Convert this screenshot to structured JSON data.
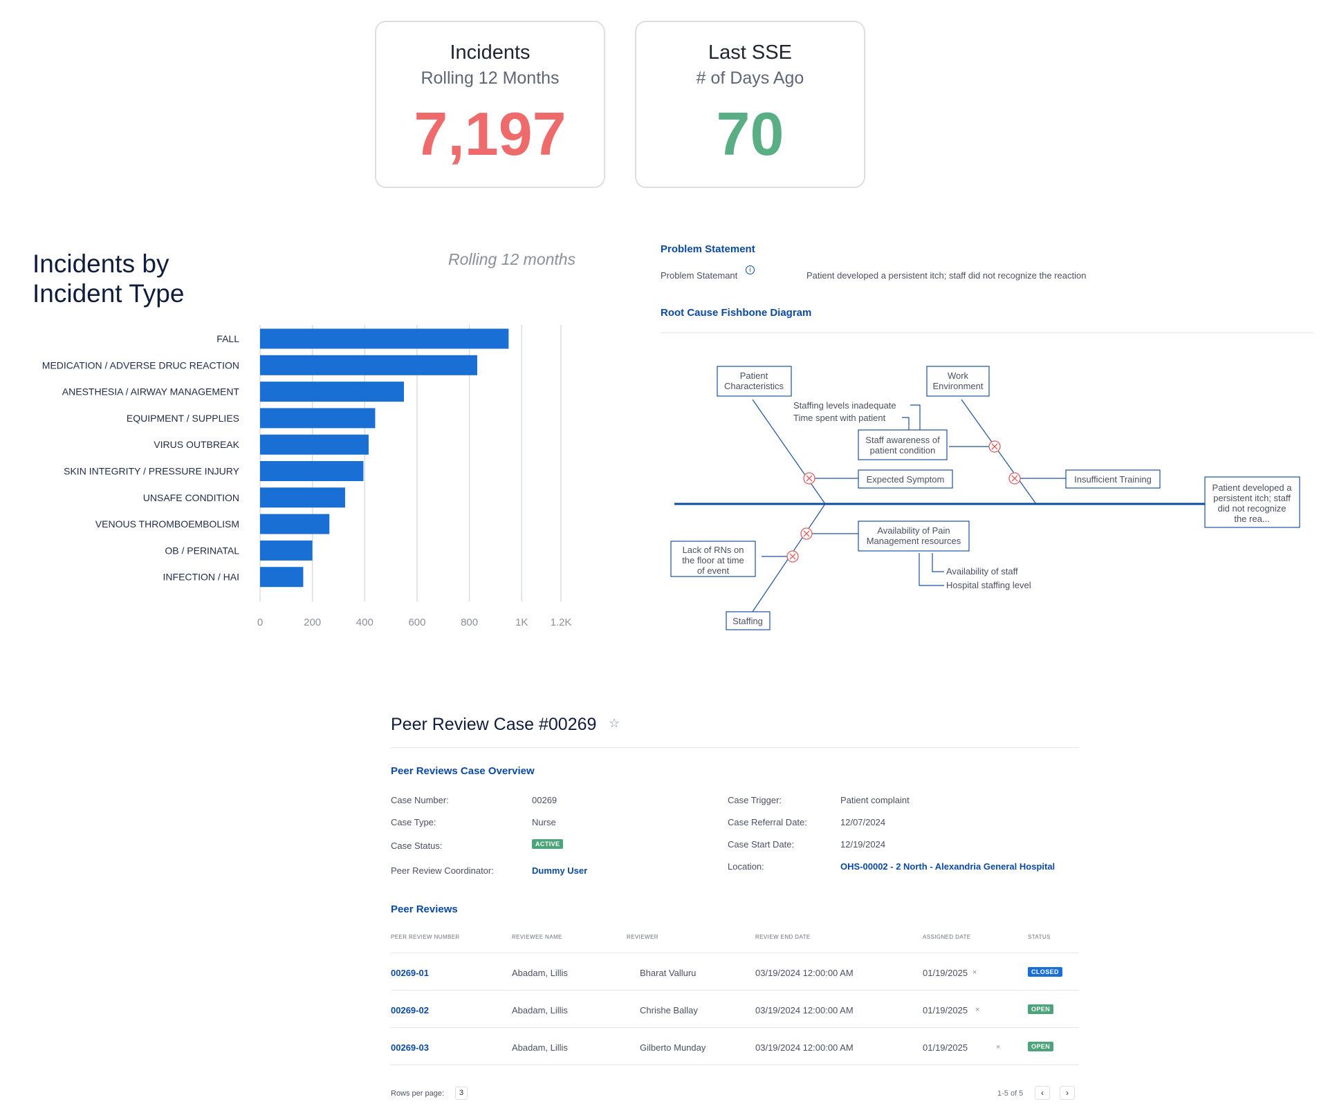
{
  "kpis": [
    {
      "title": "Incidents",
      "subtitle": "Rolling 12 Months",
      "value": "7,197",
      "color": "#ef6b6b"
    },
    {
      "title": "Last SSE",
      "subtitle": "# of Days Ago",
      "value": "70",
      "color": "#5aae84"
    }
  ],
  "bar_chart": {
    "title_line1": "Incidents by",
    "title_line2": "Incident Type",
    "subtitle": "Rolling 12 months"
  },
  "chart_data": {
    "type": "bar",
    "orientation": "horizontal",
    "categories": [
      "FALL",
      "MEDICATION / ADVERSE DRUC REACTION",
      "ANESTHESIA / AIRWAY MANAGEMENT",
      "EQUIPMENT / SUPPLIES",
      "VIRUS OUTBREAK",
      "SKIN INTEGRITY / PRESSURE INJURY",
      "UNSAFE CONDITION",
      "VENOUS THROMBOEMBOLISM",
      "OB / PERINATAL",
      "INFECTION / HAI"
    ],
    "values": [
      950,
      830,
      550,
      440,
      415,
      395,
      325,
      265,
      200,
      165
    ],
    "xlim": [
      0,
      1150
    ],
    "ticks": [
      0,
      200,
      400,
      600,
      800,
      1000,
      1150
    ],
    "tick_labels": [
      "0",
      "200",
      "400",
      "600",
      "800",
      "1K",
      "1.2K"
    ],
    "grid": true,
    "color": "#1a6fd4"
  },
  "problem": {
    "heading": "Problem Statement",
    "label": "Problem Statemant",
    "text": "Patient developed a persistent itch; staff did not recognize the reaction"
  },
  "fishbone": {
    "heading": "Root Cause Fishbone Diagram",
    "patient_char": [
      "Patient",
      "Characteristics"
    ],
    "work_env": [
      "Work",
      "Environment"
    ],
    "staffing_inadequate": "Staffing levels inadequate",
    "time_spent": "Time spent with patient",
    "staff_awareness": [
      "Staff awareness of",
      "patient condition"
    ],
    "expected_symptom": "Expected Symptom",
    "insufficient_training": "Insufficient Training",
    "outcome": [
      "Patient developed a",
      "persistent itch; staff",
      "did not recognize",
      "the rea..."
    ],
    "lack_rns": [
      "Lack of RNs on",
      "the floor at time",
      "of event"
    ],
    "availability_pain": [
      "Availability of Pain",
      "Management resources"
    ],
    "availability_staff": "Availability of staff",
    "hospital_staffing": "Hospital staffing level",
    "staffing": "Staffing"
  },
  "case": {
    "title": "Peer Review Case #00269",
    "overview_heading": "Peer Reviews Case Overview",
    "left": [
      {
        "label": "Case Number:",
        "value": "00269"
      },
      {
        "label": "Case Type:",
        "value": "Nurse"
      },
      {
        "label": "Case Status:",
        "value": "ACTIVE"
      },
      {
        "label": "Peer Review Coordinator:",
        "value": "Dummy User"
      }
    ],
    "right": [
      {
        "label": "Case Trigger:",
        "value": "Patient complaint"
      },
      {
        "label": "Case Referral Date:",
        "value": "12/07/2024"
      },
      {
        "label": "Case Start Date:",
        "value": "12/19/2024"
      },
      {
        "label": "Location:",
        "value": "OHS-00002 - 2 North - Alexandria General Hospital"
      }
    ]
  },
  "reviews": {
    "heading": "Peer Reviews",
    "columns": [
      "PEER REVIEW NUMBER",
      "REVIEWEE NAME",
      "REVIEWER",
      "REVIEW END DATE",
      "ASSIGNED DATE",
      "STATUS"
    ],
    "rows": [
      {
        "number": "00269-01",
        "reviewee": "Abadam, Lillis",
        "reviewer": "Bharat Valluru",
        "end": "03/19/2024 12:00:00 AM",
        "assigned": "01/19/2025",
        "status": "CLOSED"
      },
      {
        "number": "00269-02",
        "reviewee": "Abadam, Lillis",
        "reviewer": "Chrishe Ballay",
        "end": "03/19/2024 12:00:00 AM",
        "assigned": "01/19/2025",
        "status": "OPEN"
      },
      {
        "number": "00269-03",
        "reviewee": "Abadam, Lillis",
        "reviewer": "Gilberto Munday",
        "end": "03/19/2024 12:00:00 AM",
        "assigned": "01/19/2025",
        "status": "OPEN"
      }
    ],
    "rows_per_page_label": "Rows per page:",
    "rows_per_page": "3",
    "range": "1-5 of 5"
  },
  "icons": {
    "star": "star-icon",
    "info": "info-icon",
    "clear": "x-icon",
    "prev": "chevron-left-icon",
    "next": "chevron-right-icon"
  }
}
